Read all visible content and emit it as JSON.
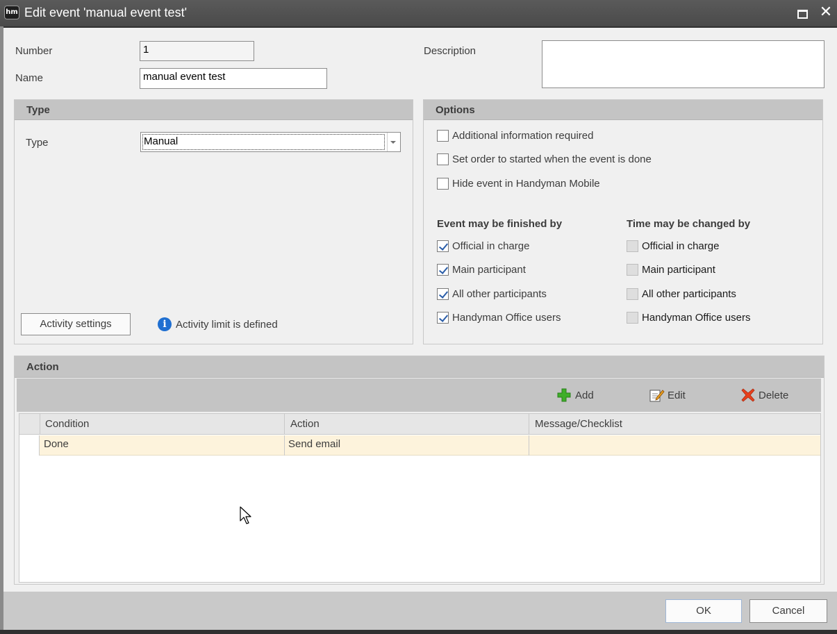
{
  "window": {
    "logo": "hm",
    "title": "Edit event 'manual event test'",
    "maximize_icon": "maximize-icon",
    "close_icon": "close-icon",
    "close_glyph": "✕"
  },
  "form": {
    "number_label": "Number",
    "number_value": "1",
    "name_label": "Name",
    "name_value": "manual event test",
    "description_label": "Description",
    "description_value": ""
  },
  "type_group": {
    "title": "Type",
    "type_label": "Type",
    "type_value": "Manual",
    "activity_settings_label": "Activity settings",
    "activity_limit_text": "Activity limit is defined"
  },
  "options_group": {
    "title": "Options",
    "checkboxes": [
      {
        "label": "Additional information required",
        "checked": false
      },
      {
        "label": "Set order to started when the event is done",
        "checked": false
      },
      {
        "label": "Hide event in Handyman Mobile",
        "checked": false
      }
    ],
    "finished_by": {
      "title": "Event may be finished by",
      "items": [
        {
          "label": "Official in charge",
          "checked": true
        },
        {
          "label": "Main participant",
          "checked": true
        },
        {
          "label": "All other participants",
          "checked": true
        },
        {
          "label": "Handyman Office users",
          "checked": true
        }
      ]
    },
    "time_changed_by": {
      "title": "Time may be changed by",
      "items": [
        {
          "label": "Official in charge",
          "checked": false,
          "disabled": true
        },
        {
          "label": "Main participant",
          "checked": false,
          "disabled": true
        },
        {
          "label": "All other participants",
          "checked": false,
          "disabled": true
        },
        {
          "label": "Handyman Office users",
          "checked": false,
          "disabled": true
        }
      ]
    }
  },
  "action_group": {
    "title": "Action",
    "toolbar": {
      "add_label": "Add",
      "edit_label": "Edit",
      "delete_label": "Delete"
    },
    "columns": [
      "Condition",
      "Action",
      "Message/Checklist"
    ],
    "rows": [
      {
        "condition": "Done",
        "action": "Send email",
        "message": ""
      }
    ]
  },
  "footer": {
    "ok_label": "OK",
    "cancel_label": "Cancel"
  },
  "colors": {
    "title_bar": "#4f4f4f",
    "group_header": "#c4c4c4",
    "selected_row": "#fdf3dc",
    "check_mark": "#2a5da8",
    "add_icon": "#3fae2a",
    "delete_icon": "#e8401c",
    "info_icon": "#1f6fd1"
  }
}
